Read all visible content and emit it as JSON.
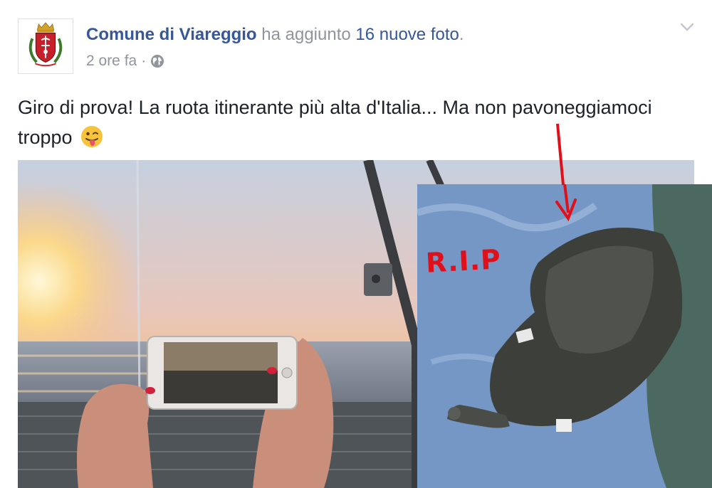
{
  "post": {
    "page_name": "Comune di Viareggio",
    "action_prefix": "ha aggiunto",
    "photo_count_text": "16 nuove foto",
    "action_suffix": ".",
    "timestamp": "2 ore fa",
    "meta_separator": "·",
    "privacy_icon": "globe-icon",
    "menu_icon": "chevron-down-icon",
    "text_line": "Giro di prova! La ruota itinerante più alta d'Italia... Ma non pavoneggiamoci troppo",
    "emoji": "winking-tongue-emoji"
  },
  "overlay": {
    "annotation": "R.I.P"
  },
  "colors": {
    "link": "#365899",
    "meta": "#90949c",
    "text": "#1d2129",
    "annotation": "#e0101a"
  }
}
